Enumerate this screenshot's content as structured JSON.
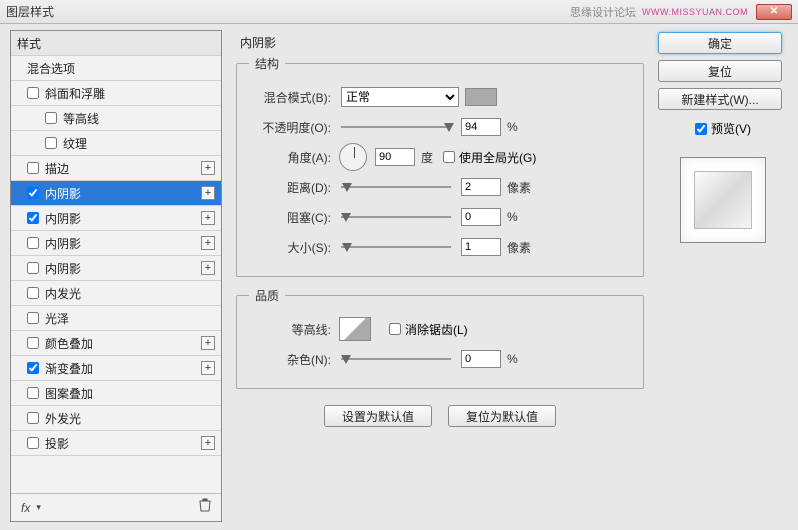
{
  "titlebar": {
    "title": "图层样式",
    "credits": "思缘设计论坛",
    "url": "WWW.MISSYUAN.COM"
  },
  "sidebar": {
    "header": "样式",
    "blending": "混合选项",
    "items": [
      {
        "label": "斜面和浮雕",
        "checked": false,
        "indent": 1,
        "plus": false
      },
      {
        "label": "等高线",
        "checked": false,
        "indent": 2,
        "plus": false
      },
      {
        "label": "纹理",
        "checked": false,
        "indent": 2,
        "plus": false
      },
      {
        "label": "描边",
        "checked": false,
        "indent": 1,
        "plus": true
      },
      {
        "label": "内阴影",
        "checked": true,
        "indent": 1,
        "plus": true,
        "selected": true
      },
      {
        "label": "内阴影",
        "checked": true,
        "indent": 1,
        "plus": true
      },
      {
        "label": "内阴影",
        "checked": false,
        "indent": 1,
        "plus": true
      },
      {
        "label": "内阴影",
        "checked": false,
        "indent": 1,
        "plus": true
      },
      {
        "label": "内发光",
        "checked": false,
        "indent": 1,
        "plus": false
      },
      {
        "label": "光泽",
        "checked": false,
        "indent": 1,
        "plus": false
      },
      {
        "label": "颜色叠加",
        "checked": false,
        "indent": 1,
        "plus": true
      },
      {
        "label": "渐变叠加",
        "checked": true,
        "indent": 1,
        "plus": true
      },
      {
        "label": "图案叠加",
        "checked": false,
        "indent": 1,
        "plus": false
      },
      {
        "label": "外发光",
        "checked": false,
        "indent": 1,
        "plus": false
      },
      {
        "label": "投影",
        "checked": false,
        "indent": 1,
        "plus": true
      }
    ],
    "fx": "fx"
  },
  "panel": {
    "title": "内阴影",
    "structure": {
      "legend": "结构",
      "blend_label": "混合模式(B):",
      "blend_value": "正常",
      "opacity_label": "不透明度(O):",
      "opacity_value": "94",
      "opacity_unit": "%",
      "angle_label": "角度(A):",
      "angle_value": "90",
      "angle_unit": "度",
      "global_light": "使用全局光(G)",
      "distance_label": "距离(D):",
      "distance_value": "2",
      "distance_unit": "像素",
      "choke_label": "阻塞(C):",
      "choke_value": "0",
      "choke_unit": "%",
      "size_label": "大小(S):",
      "size_value": "1",
      "size_unit": "像素"
    },
    "quality": {
      "legend": "品质",
      "contour_label": "等高线:",
      "antialias": "消除锯齿(L)",
      "noise_label": "杂色(N):",
      "noise_value": "0",
      "noise_unit": "%"
    },
    "defaults_btn": "设置为默认值",
    "reset_btn": "复位为默认值"
  },
  "right": {
    "ok": "确定",
    "cancel": "复位",
    "newstyle": "新建样式(W)...",
    "preview": "预览(V)"
  }
}
